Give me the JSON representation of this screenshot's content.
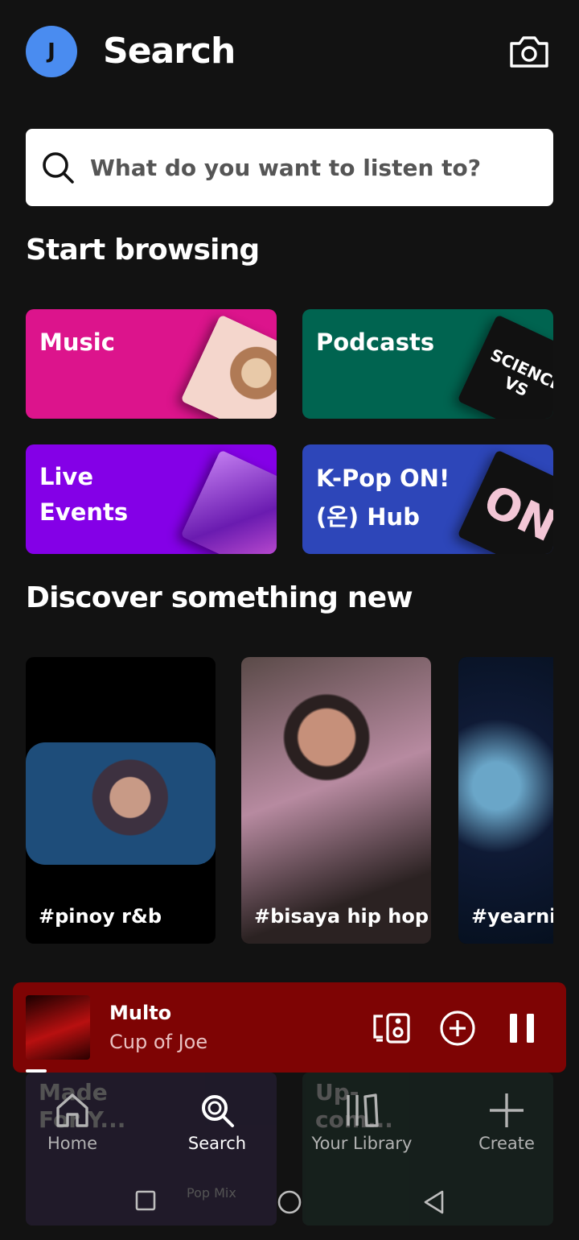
{
  "header": {
    "avatar_initial": "J",
    "title": "Search"
  },
  "search": {
    "placeholder": "What do you want to listen to?"
  },
  "browse": {
    "title": "Start browsing",
    "tiles": [
      {
        "label": "Music",
        "color": "#dc148c"
      },
      {
        "label": "Podcasts",
        "color": "#006450"
      },
      {
        "label": "Live\nEvents",
        "color": "#8400e7"
      },
      {
        "label": "K-Pop ON!\n(온) Hub",
        "color": "#2d46b9"
      }
    ],
    "art_text": {
      "podcast": "SCIENCE VS",
      "kpop": "ON"
    }
  },
  "discover": {
    "title": "Discover something new",
    "cards": [
      {
        "label": "#pinoy r&b"
      },
      {
        "label": "#bisaya hip hop"
      },
      {
        "label": "#yearning"
      }
    ]
  },
  "now_playing": {
    "title": "Multo",
    "artist": "Cup of Joe",
    "progress": 0.04,
    "background": "#7e0404"
  },
  "nav": {
    "items": [
      {
        "label": "Home",
        "icon": "home-icon"
      },
      {
        "label": "Search",
        "icon": "search-icon",
        "active": true
      },
      {
        "label": "Your Library",
        "icon": "library-icon"
      },
      {
        "label": "Create",
        "icon": "plus-icon"
      }
    ]
  },
  "ghost_tiles": {
    "left": "Made For Y...",
    "right": "Up-com...",
    "caption": "Pop Mix"
  }
}
